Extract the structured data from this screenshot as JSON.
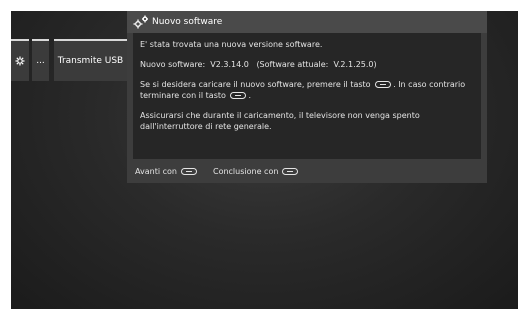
{
  "menu": {
    "tiles": [
      {
        "icon": "gear-icon",
        "label": ""
      },
      {
        "icon": "ellipsis-icon",
        "label": "..."
      },
      {
        "icon": "",
        "label": "Transmite USB"
      }
    ]
  },
  "dialog": {
    "icon": "gears-icon",
    "title": "Nuovo software",
    "line1": "E' stata trovata una nuova versione software.",
    "line2": "Nuovo software:  V2.3.14.0   (Software attuale:  V.2.1.25.0)",
    "line3_part1": "Se si desidera caricare il nuovo software, premere il tasto",
    "line3_part2": ". In caso contrario terminare con il tasto",
    "line3_part3": ".",
    "line4": "Assicurarsi che durante il caricamento, il televisore non venga spento dall'interruttore di rete generale.",
    "key_forward": "forward-key-icon",
    "key_back": "back-key-icon"
  },
  "footer": {
    "next_label": "Avanti con",
    "close_label": "Conclusione con"
  }
}
